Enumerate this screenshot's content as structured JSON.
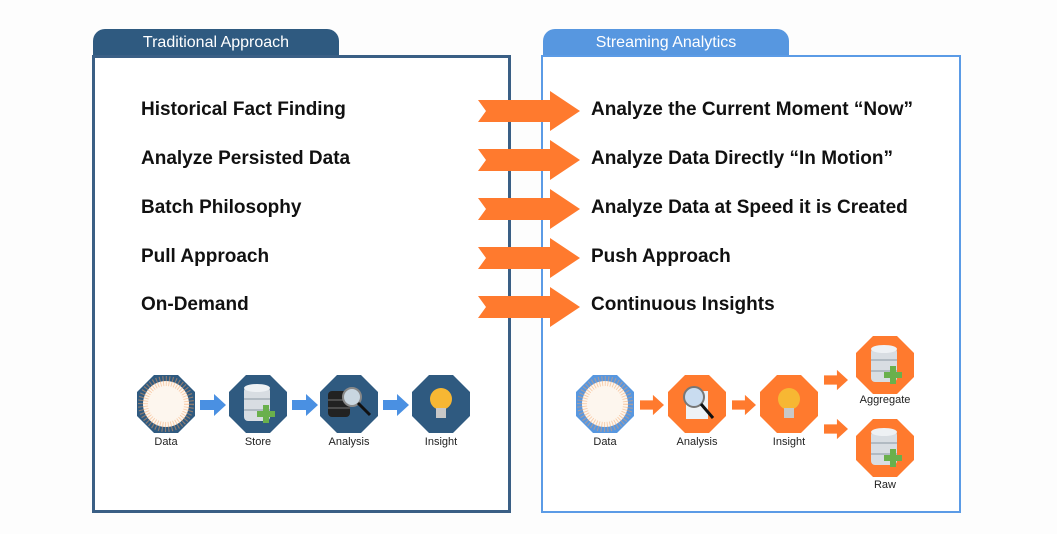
{
  "traditional": {
    "tab_label": "Traditional Approach",
    "items": [
      "Historical Fact Finding",
      "Analyze Persisted Data",
      "Batch Philosophy",
      "Pull Approach",
      "On-Demand"
    ],
    "flow": [
      "Data",
      "Store",
      "Analysis",
      "Insight"
    ]
  },
  "streaming": {
    "tab_label": "Streaming Analytics",
    "items": [
      "Analyze the Current Moment “Now”",
      "Analyze Data Directly “In Motion”",
      "Analyze Data at Speed it is Created",
      "Push Approach",
      "Continuous Insights"
    ],
    "flow": [
      "Data",
      "Analysis",
      "Insight"
    ],
    "outputs": [
      "Aggregate",
      "Raw"
    ]
  },
  "colors": {
    "traditional": "#2f5a80",
    "streaming": "#5797e0",
    "arrow": "#ff7a2e"
  },
  "icons": {
    "transition_arrow": "arrow-right-icon",
    "data": "data-globe-icon",
    "store": "database-add-icon",
    "analysis": "magnifier-icon",
    "insight": "lightbulb-icon"
  }
}
